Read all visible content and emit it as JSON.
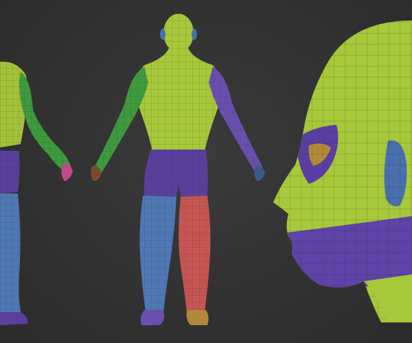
{
  "scene": {
    "background": "#333333",
    "views": [
      {
        "name": "side-view-body",
        "description_icon": "human-figure-icon"
      },
      {
        "name": "back-view-body",
        "description_icon": "human-figure-icon"
      },
      {
        "name": "head-profile",
        "description_icon": "head-icon"
      }
    ],
    "polygroup_colors": {
      "torso": "#a7c83a",
      "arms": "#3f9a3e",
      "shorts": "#5a3f9e",
      "left_leg": "#4f78b5",
      "right_leg": "#c65552",
      "eye_band": "#5b3ea3",
      "ear": "#4a6fb0",
      "neck_band": "#5f43a8"
    },
    "wireframe_color": "#2a3a1a"
  }
}
